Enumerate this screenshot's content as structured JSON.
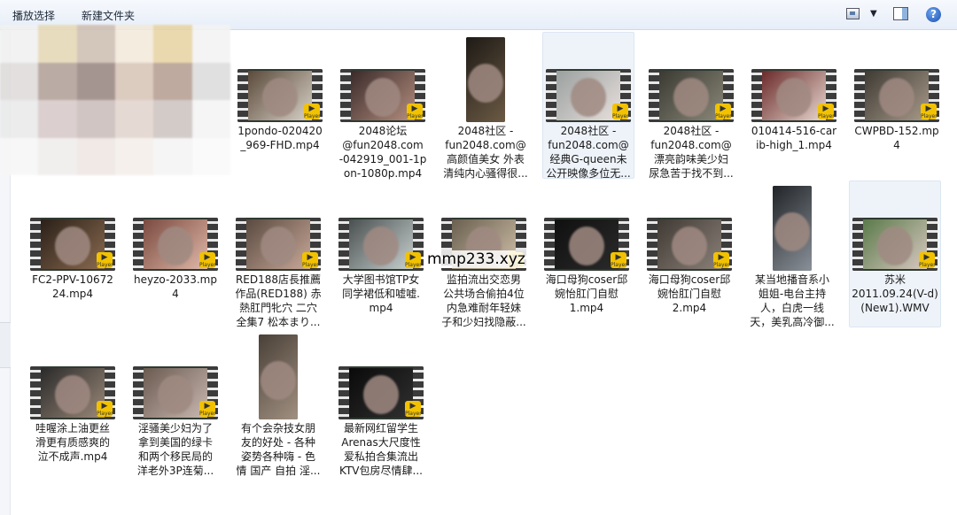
{
  "toolbar": {
    "play_selection": "播放选择",
    "new_folder": "新建文件夹",
    "view_icon": "view-options-icon",
    "preview_pane_icon": "preview-pane-icon",
    "help_icon": "help-icon",
    "help_glyph": "?"
  },
  "watermark": "mmp233.xyz",
  "badge_label": "Player",
  "badge_glyph": "▶",
  "files": [
    {
      "name": "1pondo-020420_969-FHD.mp4",
      "line1": "1pondo-020420",
      "line2": "_969-FHD.mp4",
      "line3": "",
      "line4": ""
    },
    {
      "name": "2048论坛@fun2048.com-042919_001-1pon-1080p.mp4",
      "line1": "2048论坛",
      "line2": "@fun2048.com",
      "line3": "-042919_001-1p",
      "line4": "on-1080p.mp4"
    },
    {
      "name": "2048社区 - fun2048.com@高颜值美女 外表清纯内心骚得很...",
      "line1": "2048社区 -",
      "line2": "fun2048.com@",
      "line3": "高颜值美女 外表",
      "line4": "清纯内心骚得很..."
    },
    {
      "name": "2048社区 - fun2048.com@经典G-queen未公开映像多位无...",
      "line1": "2048社区 -",
      "line2": "fun2048.com@",
      "line3": "经典G-queen未",
      "line4": "公开映像多位无..."
    },
    {
      "name": "2048社区 - fun2048.com@漂亮韵味美少妇尿急苦于找不到...",
      "line1": "2048社区 -",
      "line2": "fun2048.com@",
      "line3": "漂亮韵味美少妇",
      "line4": "尿急苦于找不到..."
    },
    {
      "name": "010414-516-carib-high_1.mp4",
      "line1": "010414-516-car",
      "line2": "ib-high_1.mp4",
      "line3": "",
      "line4": ""
    },
    {
      "name": "CWPBD-152.mp4",
      "line1": "CWPBD-152.mp",
      "line2": "4",
      "line3": "",
      "line4": ""
    },
    {
      "name": "FC2-PPV-1067224.mp4",
      "line1": "FC2-PPV-10672",
      "line2": "24.mp4",
      "line3": "",
      "line4": ""
    },
    {
      "name": "heyzo-2033.mp4",
      "line1": "heyzo-2033.mp",
      "line2": "4",
      "line3": "",
      "line4": ""
    },
    {
      "name": "RED188店長推薦作品(RED188) 赤熱肛門牝穴 二穴全集7 松本まり...",
      "line1": "RED188店長推薦",
      "line2": "作品(RED188) 赤",
      "line3": "熱肛門牝穴 二穴",
      "line4": "全集7 松本まり..."
    },
    {
      "name": "大学图书馆TP女同学裙低和嘘嘘.mp4",
      "line1": "大学图书馆TP女",
      "line2": "同学裙低和嘘嘘.",
      "line3": "mp4",
      "line4": ""
    },
    {
      "name": "监拍流出交恋男公共场合偷拍4位内急难耐年轻妹子和少妇找隐蔽...",
      "line1": "监拍流出交恋男",
      "line2": "公共场合偷拍4位",
      "line3": "内急难耐年轻妹",
      "line4": "子和少妇找隐蔽..."
    },
    {
      "name": "海口母狗coser邱婉怡肛门自慰1.mp4",
      "line1": "海口母狗coser邱",
      "line2": "婉怡肛门自慰",
      "line3": "1.mp4",
      "line4": ""
    },
    {
      "name": "海口母狗coser邱婉怡肛门自慰2.mp4",
      "line1": "海口母狗coser邱",
      "line2": "婉怡肛门自慰",
      "line3": "2.mp4",
      "line4": ""
    },
    {
      "name": "某当地播音系小姐姐-电台主持人，白虎一线天，美乳高冷御...",
      "line1": "某当地播音系小",
      "line2": "姐姐-电台主持",
      "line3": "人，白虎一线",
      "line4": "天，美乳高冷御..."
    },
    {
      "name": "苏米2011.09.24(V-d)(New1).WMV",
      "line1": "苏米",
      "line2": "2011.09.24(V-d)",
      "line3": "(New1).WMV",
      "line4": ""
    },
    {
      "name": "哇喔涂上油更丝滑更有质感爽的泣不成声.mp4",
      "line1": "哇喔涂上油更丝",
      "line2": "滑更有质感爽的",
      "line3": "泣不成声.mp4",
      "line4": ""
    },
    {
      "name": "淫骚美少妇为了拿到美国的绿卡和两个移民局的洋老外3P连菊...",
      "line1": "淫骚美少妇为了",
      "line2": "拿到美国的绿卡",
      "line3": "和两个移民局的",
      "line4": "洋老外3P连菊..."
    },
    {
      "name": "有个会杂技女朋友的好处 - 各种姿势各种嗨 - 色情 国产 自拍 淫...",
      "line1": "有个会杂技女朋",
      "line2": "友的好处 - 各种",
      "line3": "姿势各种嗨 - 色",
      "line4": "情 国产 自拍 淫..."
    },
    {
      "name": "最新网红留学生Arenas大尺度性爱私拍合集流出KTV包房尽情肆...",
      "line1": "最新网红留学生",
      "line2": "Arenas大尺度性",
      "line3": "爱私拍合集流出",
      "line4": "KTV包房尽情肆..."
    }
  ]
}
